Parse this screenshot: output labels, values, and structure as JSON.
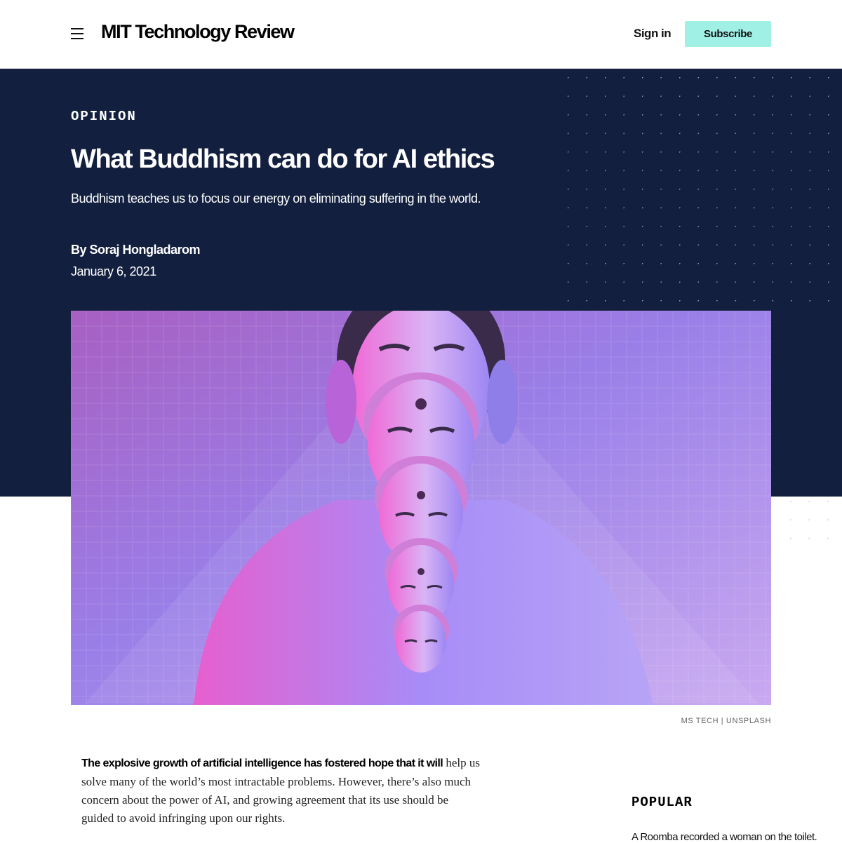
{
  "header": {
    "logo": "MIT Technology Review",
    "signin_label": "Sign in",
    "subscribe_label": "Subscribe",
    "subscribe_color": "#a0f0e6"
  },
  "article": {
    "kicker": "OPINION",
    "title": "What Buddhism can do for AI ethics",
    "dek": "Buddhism teaches us to focus our energy on eliminating suffering in the world.",
    "byline": "By Soraj Hongladarom",
    "date": "January 6, 2021",
    "hero_background": "#121f3e",
    "image_credit": "MS TECH | UNSPLASH",
    "lead_in": "The explosive growth of artificial intelligence has fostered hope that it will",
    "body_rest": "help us solve many of the world’s most intractable problems. However, there’s also much concern about the power of AI, and growing agreement that its use should be guided to avoid infringing upon our rights."
  },
  "popular": {
    "heading": "POPULAR",
    "first_item": "A Roomba recorded a woman on the toilet."
  }
}
